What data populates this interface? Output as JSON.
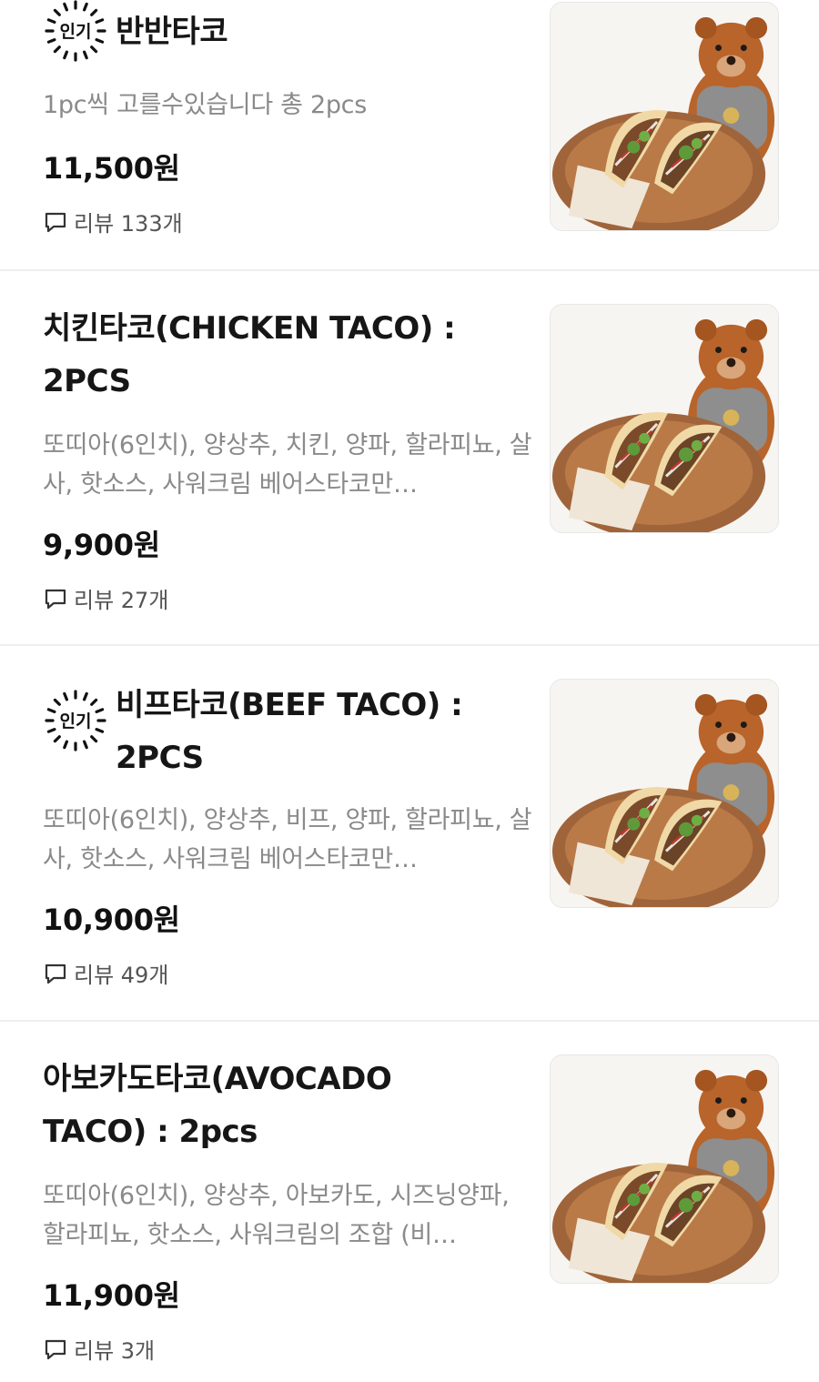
{
  "menu": {
    "items": [
      {
        "badge": "인기",
        "title": "반반타코",
        "description": "1pc씩 고를수있습니다 총 2pcs",
        "price": "11,500원",
        "reviews": "리뷰 133개",
        "image_icon": "taco-plate-photo"
      },
      {
        "title": "치킨타코(CHICKEN TACO) : 2PCS",
        "description": "또띠아(6인치), 양상추, 치킨, 양파, 할라피뇨, 살사, 핫소스, 사워크림 베어스타코만…",
        "price": "9,900원",
        "reviews": "리뷰 27개",
        "image_icon": "taco-plate-photo"
      },
      {
        "badge": "인기",
        "title": "비프타코(BEEF TACO) : 2PCS",
        "description": "또띠아(6인치), 양상추, 비프, 양파, 할라피뇨, 살사, 핫소스, 사워크림 베어스타코만…",
        "price": "10,900원",
        "reviews": "리뷰 49개",
        "image_icon": "taco-plate-photo"
      },
      {
        "title": "아보카도타코(AVOCADO TACO) : 2pcs",
        "description": "또띠아(6인치), 양상추, 아보카도, 시즈닝양파, 할라피뇨, 핫소스, 사워크림의 조합 (비…",
        "price": "11,900원",
        "reviews": "리뷰 3개",
        "image_icon": "taco-plate-photo"
      }
    ]
  },
  "colors": {
    "title": "#161616",
    "description": "#8a8a8a",
    "divider": "#eeeeee",
    "plate": "#a0643a",
    "tortilla": "#f0d9a6",
    "bear": "#b8642a",
    "hoodie": "#8e8e8e"
  }
}
